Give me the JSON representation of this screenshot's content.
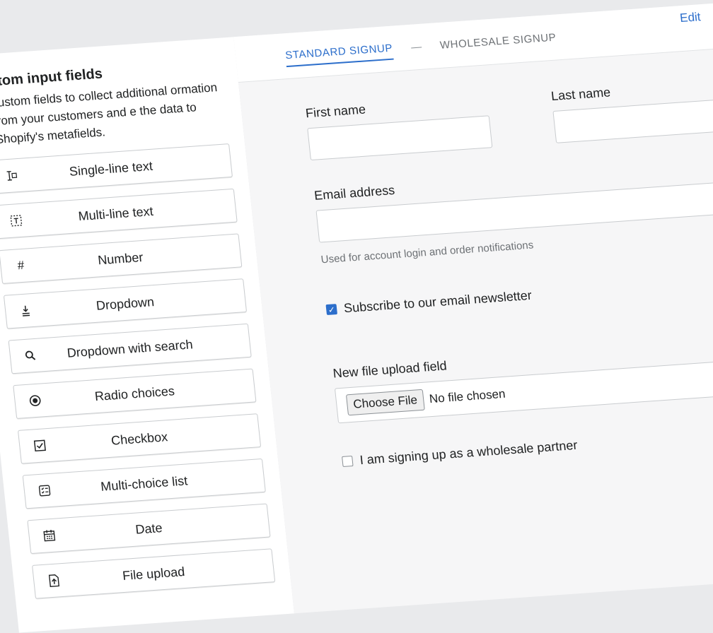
{
  "sidebar": {
    "title": "stom input fields",
    "description": "custom fields to collect additional ormation from your customers and e the data to Shopify's metafields.",
    "items": [
      {
        "label": "Single-line text",
        "icon": "single-line-text-icon"
      },
      {
        "label": "Multi-line text",
        "icon": "multi-line-text-icon"
      },
      {
        "label": "Number",
        "icon": "number-icon"
      },
      {
        "label": "Dropdown",
        "icon": "dropdown-icon"
      },
      {
        "label": "Dropdown with search",
        "icon": "search-icon"
      },
      {
        "label": "Radio choices",
        "icon": "radio-icon"
      },
      {
        "label": "Checkbox",
        "icon": "checkbox-icon"
      },
      {
        "label": "Multi-choice list",
        "icon": "multi-choice-icon"
      },
      {
        "label": "Date",
        "icon": "calendar-icon"
      },
      {
        "label": "File upload",
        "icon": "file-upload-icon"
      }
    ]
  },
  "header": {
    "tabs": [
      {
        "label": "STANDARD SIGNUP",
        "active": true
      },
      {
        "label": "WHOLESALE SIGNUP",
        "active": false
      }
    ],
    "separator": "—",
    "edit_label": "Edit"
  },
  "form": {
    "first_name_label": "First name",
    "last_name_label": "Last name",
    "email_label": "Email address",
    "email_help": "Used for account login and order notifications",
    "newsletter_label": "Subscribe to our email newsletter",
    "newsletter_checked": true,
    "file_label": "New file upload field",
    "file_button": "Choose File",
    "file_status": "No file chosen",
    "wholesale_label": "I am signing up as a wholesale partner",
    "wholesale_checked": false
  },
  "colors": {
    "accent": "#2c6ecb",
    "border": "#c9cccf",
    "muted": "#6d7175"
  }
}
